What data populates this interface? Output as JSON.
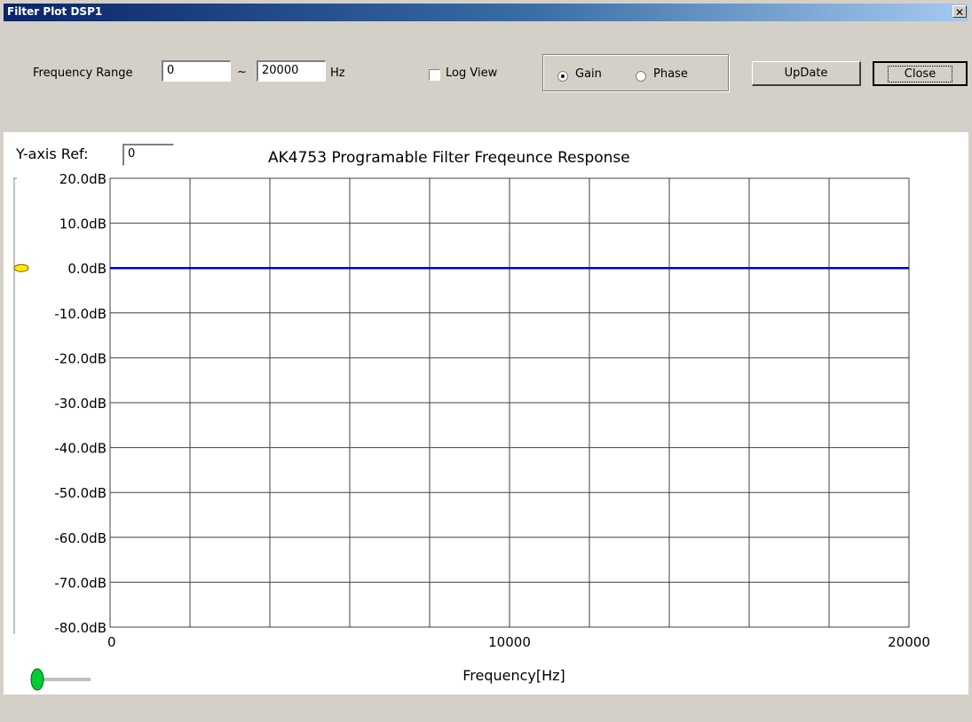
{
  "window": {
    "title": "Filter Plot DSP1",
    "close_glyph": "✕"
  },
  "toolbar": {
    "freq_range_label": "Frequency Range",
    "freq_min": "0",
    "tilde": "~",
    "freq_max": "20000",
    "unit": "Hz",
    "log_view_label": "Log View",
    "log_view_checked": false,
    "gain_label": "Gain",
    "phase_label": "Phase",
    "selected_mode": "Gain",
    "update_label": "UpDate",
    "close_label": "Close"
  },
  "plot": {
    "y_ref_label": "Y-axis Ref:",
    "y_ref_value": "0",
    "y_slider_level_db": 0,
    "x_slider_level": 0
  },
  "chart_data": {
    "type": "line",
    "title": "AK4753 Programable Filter Freqeunce Response",
    "xlabel": "Frequency[Hz]",
    "ylabel": "",
    "xlim": [
      0,
      20000
    ],
    "ylim": [
      -80,
      20
    ],
    "x_tick_labels": [
      "0",
      "10000",
      "20000"
    ],
    "x_ticks": [
      0,
      10000,
      20000
    ],
    "y_ticks": [
      20,
      10,
      0,
      -10,
      -20,
      -30,
      -40,
      -50,
      -60,
      -70,
      -80
    ],
    "y_tick_labels": [
      "20.0dB",
      "10.0dB",
      "0.0dB",
      "-10.0dB",
      "-20.0dB",
      "-30.0dB",
      "-40.0dB",
      "-50.0dB",
      "-60.0dB",
      "-70.0dB",
      "-80.0dB"
    ],
    "grid": true,
    "grid_x_divisions": 10,
    "series": [
      {
        "x": [
          0,
          20000
        ],
        "y": [
          0,
          0
        ],
        "color": "#0000cc"
      }
    ]
  },
  "colors": {
    "line": "#0000cc",
    "grid": "#404040",
    "slider_y": "#ffeb00",
    "slider_x": "#00cc33"
  }
}
